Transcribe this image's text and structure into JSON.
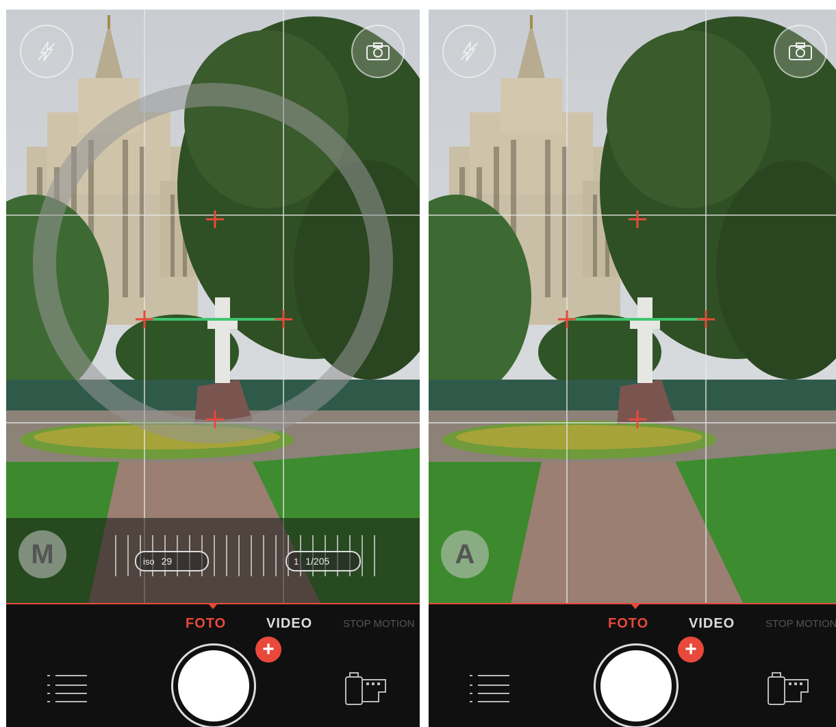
{
  "screens": [
    {
      "mode_letter": "M",
      "iso": {
        "key": "iso",
        "value": "29"
      },
      "shutter": {
        "key": "1",
        "value": "1/205"
      },
      "tabs": {
        "foto": "FOTO",
        "video": "VIDEO",
        "stop": "STOP MOTION"
      },
      "plus": "+"
    },
    {
      "mode_letter": "A",
      "tabs": {
        "foto": "FOTO",
        "video": "VIDEO",
        "stop": "STOP MOTION"
      },
      "plus": "+"
    }
  ],
  "icons": [
    "flash-off-icon",
    "switch-camera-icon",
    "menu-list-icon",
    "film-roll-icon",
    "plus-icon",
    "focus-crosshair-icon"
  ],
  "colors": {
    "accent": "#e8493b",
    "level_line": "#3ec46d",
    "bottom_bar": "#101010"
  }
}
